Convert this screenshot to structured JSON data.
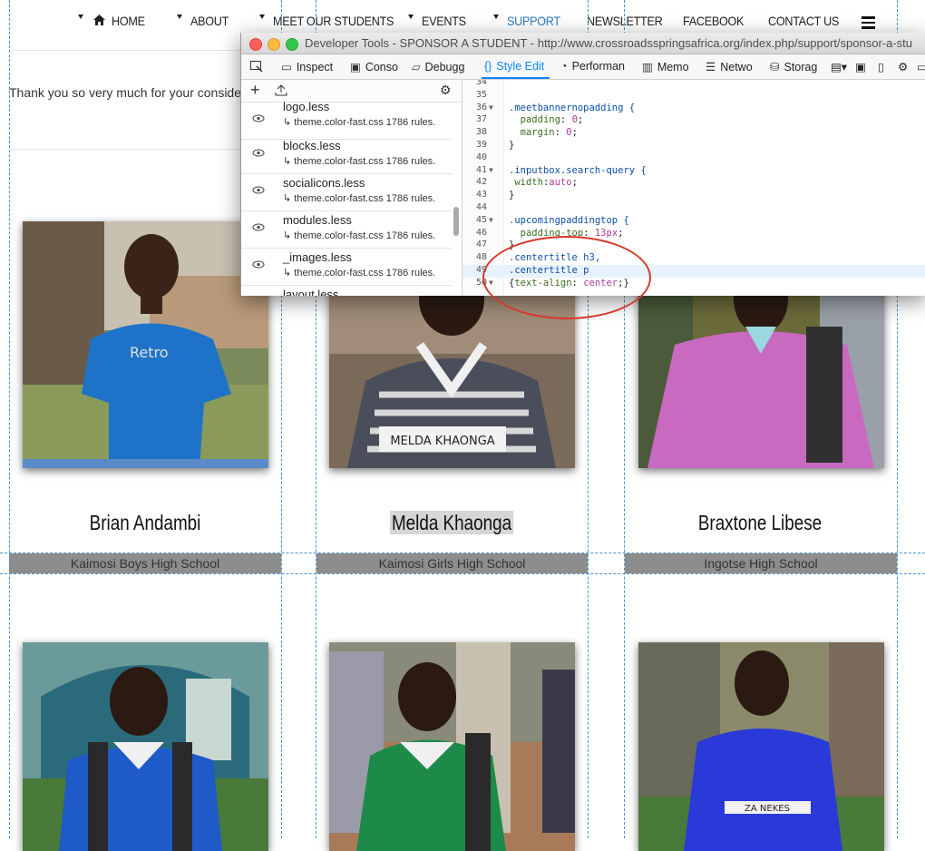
{
  "nav": {
    "items": [
      "HOME",
      "ABOUT",
      "MEET OUR STUDENTS",
      "EVENTS",
      "SUPPORT",
      "NEWSLETTER",
      "FACEBOOK",
      "CONTACT US"
    ],
    "active": "SUPPORT"
  },
  "page": {
    "intro_text": "Thank you so very much for your conside"
  },
  "students": [
    {
      "name": "Brian Andambi",
      "school": "Kaimosi Boys High School"
    },
    {
      "name": "Melda Khaonga",
      "school": "Kaimosi Girls High School"
    },
    {
      "name": "Braxtone Libese",
      "school": "Ingotse High School"
    }
  ],
  "photo_captions": {
    "melda_sign": "MELDA KHAONGA",
    "shirt_text": "Retro",
    "girl3_sign": "ZA NEKES"
  },
  "devtools": {
    "window_title": "Developer Tools - SPONSOR A STUDENT - http://www.crossroadsspringsafrica.org/index.php/support/sponsor-a-stu",
    "tabs": [
      "Inspect",
      "Conso",
      "Debugg",
      "Style Edit",
      "Performan",
      "Memo",
      "Netwo",
      "Storag"
    ],
    "selected_tab": "Style Edit",
    "stylesheets": [
      {
        "name": "logo.less",
        "source": "↳ theme.color-fast.css",
        "rules": "1786 rules."
      },
      {
        "name": "blocks.less",
        "source": "↳ theme.color-fast.css",
        "rules": "1786 rules."
      },
      {
        "name": "socialicons.less",
        "source": "↳ theme.color-fast.css",
        "rules": "1786 rules."
      },
      {
        "name": "modules.less",
        "source": "↳ theme.color-fast.css",
        "rules": "1786 rules."
      },
      {
        "name": "_images.less",
        "source": "↳ theme.color-fast.css",
        "rules": "1786 rules."
      },
      {
        "name": "layout.less",
        "source": "",
        "rules": ""
      }
    ],
    "code_lines": [
      {
        "n": "34",
        "text": ""
      },
      {
        "n": "35",
        "text": ""
      },
      {
        "n": "36",
        "text": ".meetbannernopadding {",
        "fold": true
      },
      {
        "n": "37",
        "text": "  padding: 0;"
      },
      {
        "n": "38",
        "text": "  margin: 0;"
      },
      {
        "n": "39",
        "text": "}"
      },
      {
        "n": "40",
        "text": ""
      },
      {
        "n": "41",
        "text": ".inputbox.search-query {",
        "fold": true
      },
      {
        "n": "42",
        "text": " width:auto;"
      },
      {
        "n": "43",
        "text": "}"
      },
      {
        "n": "44",
        "text": ""
      },
      {
        "n": "45",
        "text": ".upcomingpaddingtop {",
        "fold": true
      },
      {
        "n": "46",
        "text": "  padding-top: 13px;"
      },
      {
        "n": "47",
        "text": "}"
      },
      {
        "n": "48",
        "text": ".centertitle h3,"
      },
      {
        "n": "49",
        "text": ".centertitle p"
      },
      {
        "n": "50",
        "text": "{text-align: center;}",
        "fold": true
      }
    ]
  },
  "colors": {
    "accent": "#2b7bb9",
    "devtools_selected": "#0a84ff",
    "annotation": "#d6372b",
    "school_bar": "#8d8d8d"
  }
}
